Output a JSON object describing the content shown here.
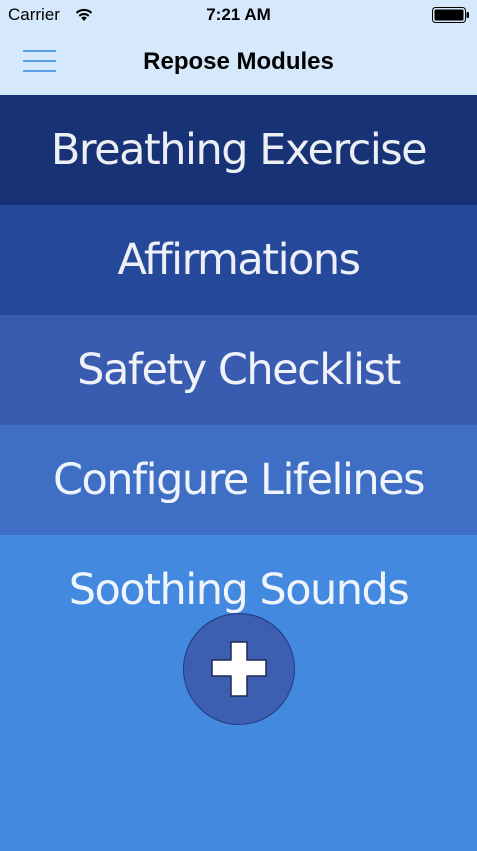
{
  "status_bar": {
    "carrier": "Carrier",
    "time": "7:21 AM",
    "wifi_icon": "wifi-icon",
    "battery_icon": "battery-icon"
  },
  "nav_bar": {
    "title": "Repose Modules",
    "menu_icon": "hamburger-menu-icon"
  },
  "modules": [
    {
      "label": "Breathing Exercise",
      "color": "#173376"
    },
    {
      "label": "Affirmations",
      "color": "#26489a"
    },
    {
      "label": "Safety Checklist",
      "color": "#3a5cb0"
    },
    {
      "label": "Configure Lifelines",
      "color": "#3e6fc5"
    },
    {
      "label": "Soothing Sounds",
      "color": "#4489e0"
    }
  ],
  "fab": {
    "icon": "plus-icon",
    "color": "#3e5eb1"
  },
  "colors": {
    "nav_background": "#d6e8fb",
    "accent": "#5a9fe5"
  }
}
